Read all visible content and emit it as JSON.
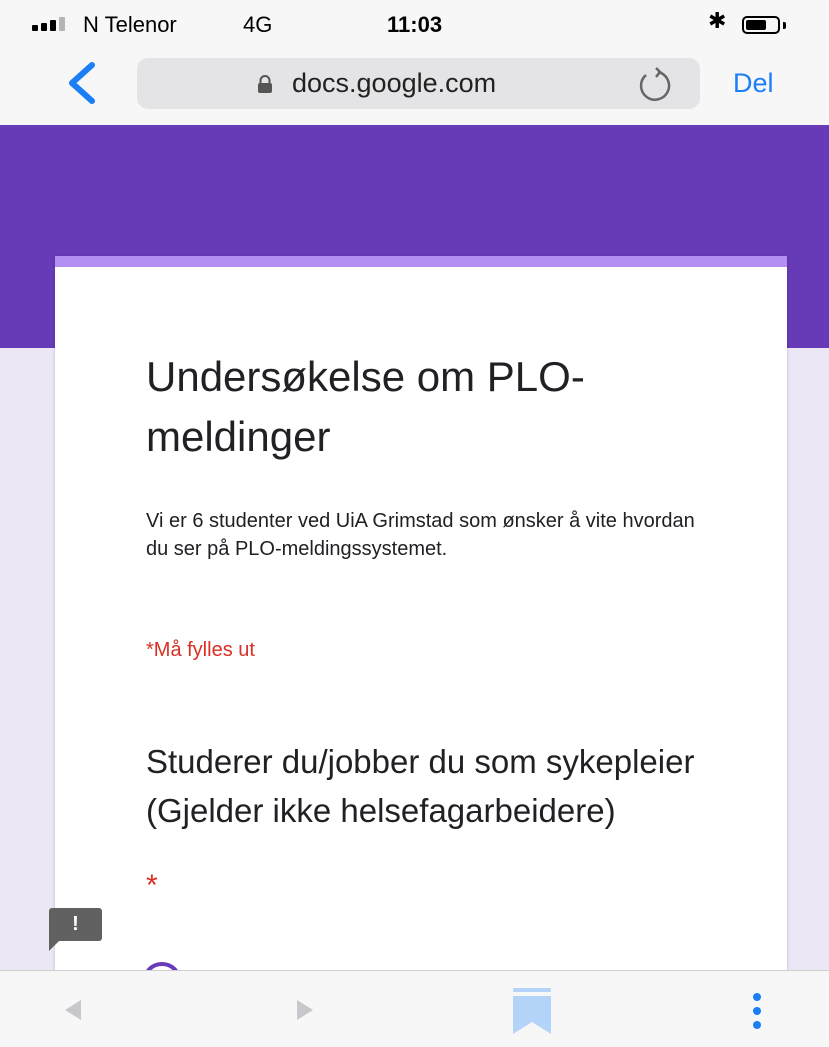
{
  "status_bar": {
    "carrier": "N Telenor",
    "network": "4G",
    "time": "11:03",
    "icons": [
      "signal-icon",
      "bluetooth-icon",
      "battery-icon"
    ]
  },
  "browser": {
    "url": "docs.google.com",
    "share_label": "Del",
    "icons": [
      "back-chevron-icon",
      "lock-icon",
      "reload-icon"
    ]
  },
  "form": {
    "title": "Undersøkelse om PLO-meldinger",
    "description": "Vi er 6 studenter ved UiA Grimstad som ønsker å vite hvordan du ser på PLO-meldingssystemet.",
    "required_note": "*Må fylles ut",
    "question": {
      "title": "Studerer du/jobber du som sykepleier (Gjelder ikke helsefagarbeidere)",
      "required_mark": "*"
    },
    "feedback_label": "!",
    "colors": {
      "header": "#673ab7",
      "card_accent": "#b38ef3",
      "required": "#d93025",
      "page_bg": "#ece7f5"
    }
  },
  "toolbar": {
    "icons": [
      "back-arrow-icon",
      "forward-arrow-icon",
      "bookmarks-icon",
      "more-icon"
    ],
    "accent": "#1b7ef5"
  }
}
